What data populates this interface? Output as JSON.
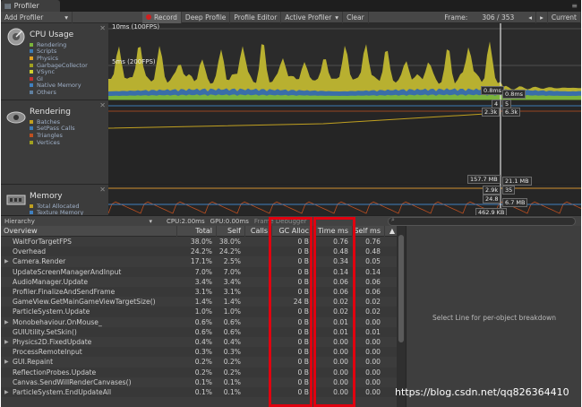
{
  "window": {
    "tab_title": "Profiler"
  },
  "toolbar": {
    "add_profiler": "Add Profiler",
    "record": "Record",
    "deep_profile": "Deep Profile",
    "profile_editor": "Profile Editor",
    "active_profiler": "Active Profiler",
    "clear": "Clear",
    "frame_label": "Frame:",
    "frame_value": "306 / 353",
    "current": "Current"
  },
  "modules": [
    {
      "title": "CPU Usage",
      "legend": [
        {
          "label": "Rendering",
          "color": "#7ab33c"
        },
        {
          "label": "Scripts",
          "color": "#3c7ab3"
        },
        {
          "label": "Physics",
          "color": "#e0a020"
        },
        {
          "label": "GarbageCollector",
          "color": "#a0a020"
        },
        {
          "label": "VSync",
          "color": "#d0d030"
        },
        {
          "label": "GI",
          "color": "#c03030"
        },
        {
          "label": "Native Memory",
          "color": "#4080c0"
        },
        {
          "label": "Others",
          "color": "#6080a0"
        }
      ]
    },
    {
      "title": "Rendering",
      "legend": [
        {
          "label": "Batches",
          "color": "#c0a020"
        },
        {
          "label": "SetPass Calls",
          "color": "#3c7ab3"
        },
        {
          "label": "Triangles",
          "color": "#c05020"
        },
        {
          "label": "Vertices",
          "color": "#a0a020"
        }
      ]
    },
    {
      "title": "Memory",
      "legend": [
        {
          "label": "Total Allocated",
          "color": "#c0a020"
        },
        {
          "label": "Texture Memory",
          "color": "#4080c0"
        },
        {
          "label": "Mesh Memory",
          "color": "#c05020"
        }
      ]
    }
  ],
  "graphs": {
    "cpu_line_10ms": "10ms (100FPS)",
    "cpu_line_5ms": "5ms (200FPS)",
    "cpu_value": "0.8ms",
    "cpu_value_right": "0.8ms",
    "rendering_values": [
      "4",
      "5",
      "2.3k",
      "6.3k"
    ],
    "memory_values": [
      "157.7 MB",
      "21.1 MB",
      "2.9k",
      "35",
      "24.8",
      "6.7 MB",
      "462.9 KB"
    ]
  },
  "hierarchy_bar": {
    "mode": "Hierarchy",
    "cpu": "CPU:2.00ms",
    "gpu": "GPU:0.00ms",
    "frame_debugger": "Frame Debugger"
  },
  "table": {
    "columns": [
      "Overview",
      "Total",
      "Self",
      "Calls",
      "GC Alloc",
      "Time ms",
      "Self ms"
    ],
    "rows": [
      {
        "name": "WaitForTargetFPS",
        "expand": false,
        "total": "38.0%",
        "self": "38.0%",
        "calls": "",
        "gc": "0 B",
        "time": "0.76",
        "selfms": "0.76"
      },
      {
        "name": "Overhead",
        "expand": false,
        "total": "24.2%",
        "self": "24.2%",
        "calls": "",
        "gc": "0 B",
        "time": "0.48",
        "selfms": "0.48"
      },
      {
        "name": "Camera.Render",
        "expand": true,
        "total": "17.1%",
        "self": "2.5%",
        "calls": "",
        "gc": "0 B",
        "time": "0.34",
        "selfms": "0.05"
      },
      {
        "name": "UpdateScreenManagerAndInput",
        "expand": false,
        "total": "7.0%",
        "self": "7.0%",
        "calls": "",
        "gc": "0 B",
        "time": "0.14",
        "selfms": "0.14"
      },
      {
        "name": "AudioManager.Update",
        "expand": false,
        "total": "3.4%",
        "self": "3.4%",
        "calls": "",
        "gc": "0 B",
        "time": "0.06",
        "selfms": "0.06"
      },
      {
        "name": "Profiler.FinalizeAndSendFrame",
        "expand": false,
        "total": "3.1%",
        "self": "3.1%",
        "calls": "",
        "gc": "0 B",
        "time": "0.06",
        "selfms": "0.06"
      },
      {
        "name": "GameView.GetMainGameViewTargetSize()",
        "expand": false,
        "total": "1.4%",
        "self": "1.4%",
        "calls": "",
        "gc": "24 B",
        "time": "0.02",
        "selfms": "0.02"
      },
      {
        "name": "ParticleSystem.Update",
        "expand": false,
        "total": "1.0%",
        "self": "1.0%",
        "calls": "",
        "gc": "0 B",
        "time": "0.02",
        "selfms": "0.02"
      },
      {
        "name": "Monobehaviour.OnMouse_",
        "expand": true,
        "total": "0.6%",
        "self": "0.6%",
        "calls": "",
        "gc": "0 B",
        "time": "0.01",
        "selfms": "0.00"
      },
      {
        "name": "GUIUtility.SetSkin()",
        "expand": false,
        "total": "0.6%",
        "self": "0.6%",
        "calls": "",
        "gc": "0 B",
        "time": "0.01",
        "selfms": "0.01"
      },
      {
        "name": "Physics2D.FixedUpdate",
        "expand": true,
        "total": "0.4%",
        "self": "0.4%",
        "calls": "",
        "gc": "0 B",
        "time": "0.00",
        "selfms": "0.00"
      },
      {
        "name": "ProcessRemoteInput",
        "expand": false,
        "total": "0.3%",
        "self": "0.3%",
        "calls": "",
        "gc": "0 B",
        "time": "0.00",
        "selfms": "0.00"
      },
      {
        "name": "GUI.Repaint",
        "expand": true,
        "total": "0.2%",
        "self": "0.2%",
        "calls": "",
        "gc": "0 B",
        "time": "0.00",
        "selfms": "0.00"
      },
      {
        "name": "ReflectionProbes.Update",
        "expand": false,
        "total": "0.2%",
        "self": "0.2%",
        "calls": "",
        "gc": "0 B",
        "time": "0.00",
        "selfms": "0.00"
      },
      {
        "name": "Canvas.SendWillRenderCanvases()",
        "expand": false,
        "total": "0.1%",
        "self": "0.1%",
        "calls": "",
        "gc": "0 B",
        "time": "0.00",
        "selfms": "0.00"
      },
      {
        "name": "ParticleSystem.EndUpdateAll",
        "expand": true,
        "total": "0.1%",
        "self": "0.1%",
        "calls": "",
        "gc": "0 B",
        "time": "0.00",
        "selfms": "0.00"
      }
    ]
  },
  "detail": {
    "message": "Select Line for per-object breakdown"
  },
  "watermark": "https://blog.csdn.net/qq826364410",
  "colors": {
    "highlight": "#e0000f",
    "cpu_fill": "#b8b030",
    "rendering_fill": "#3a7ac0"
  }
}
